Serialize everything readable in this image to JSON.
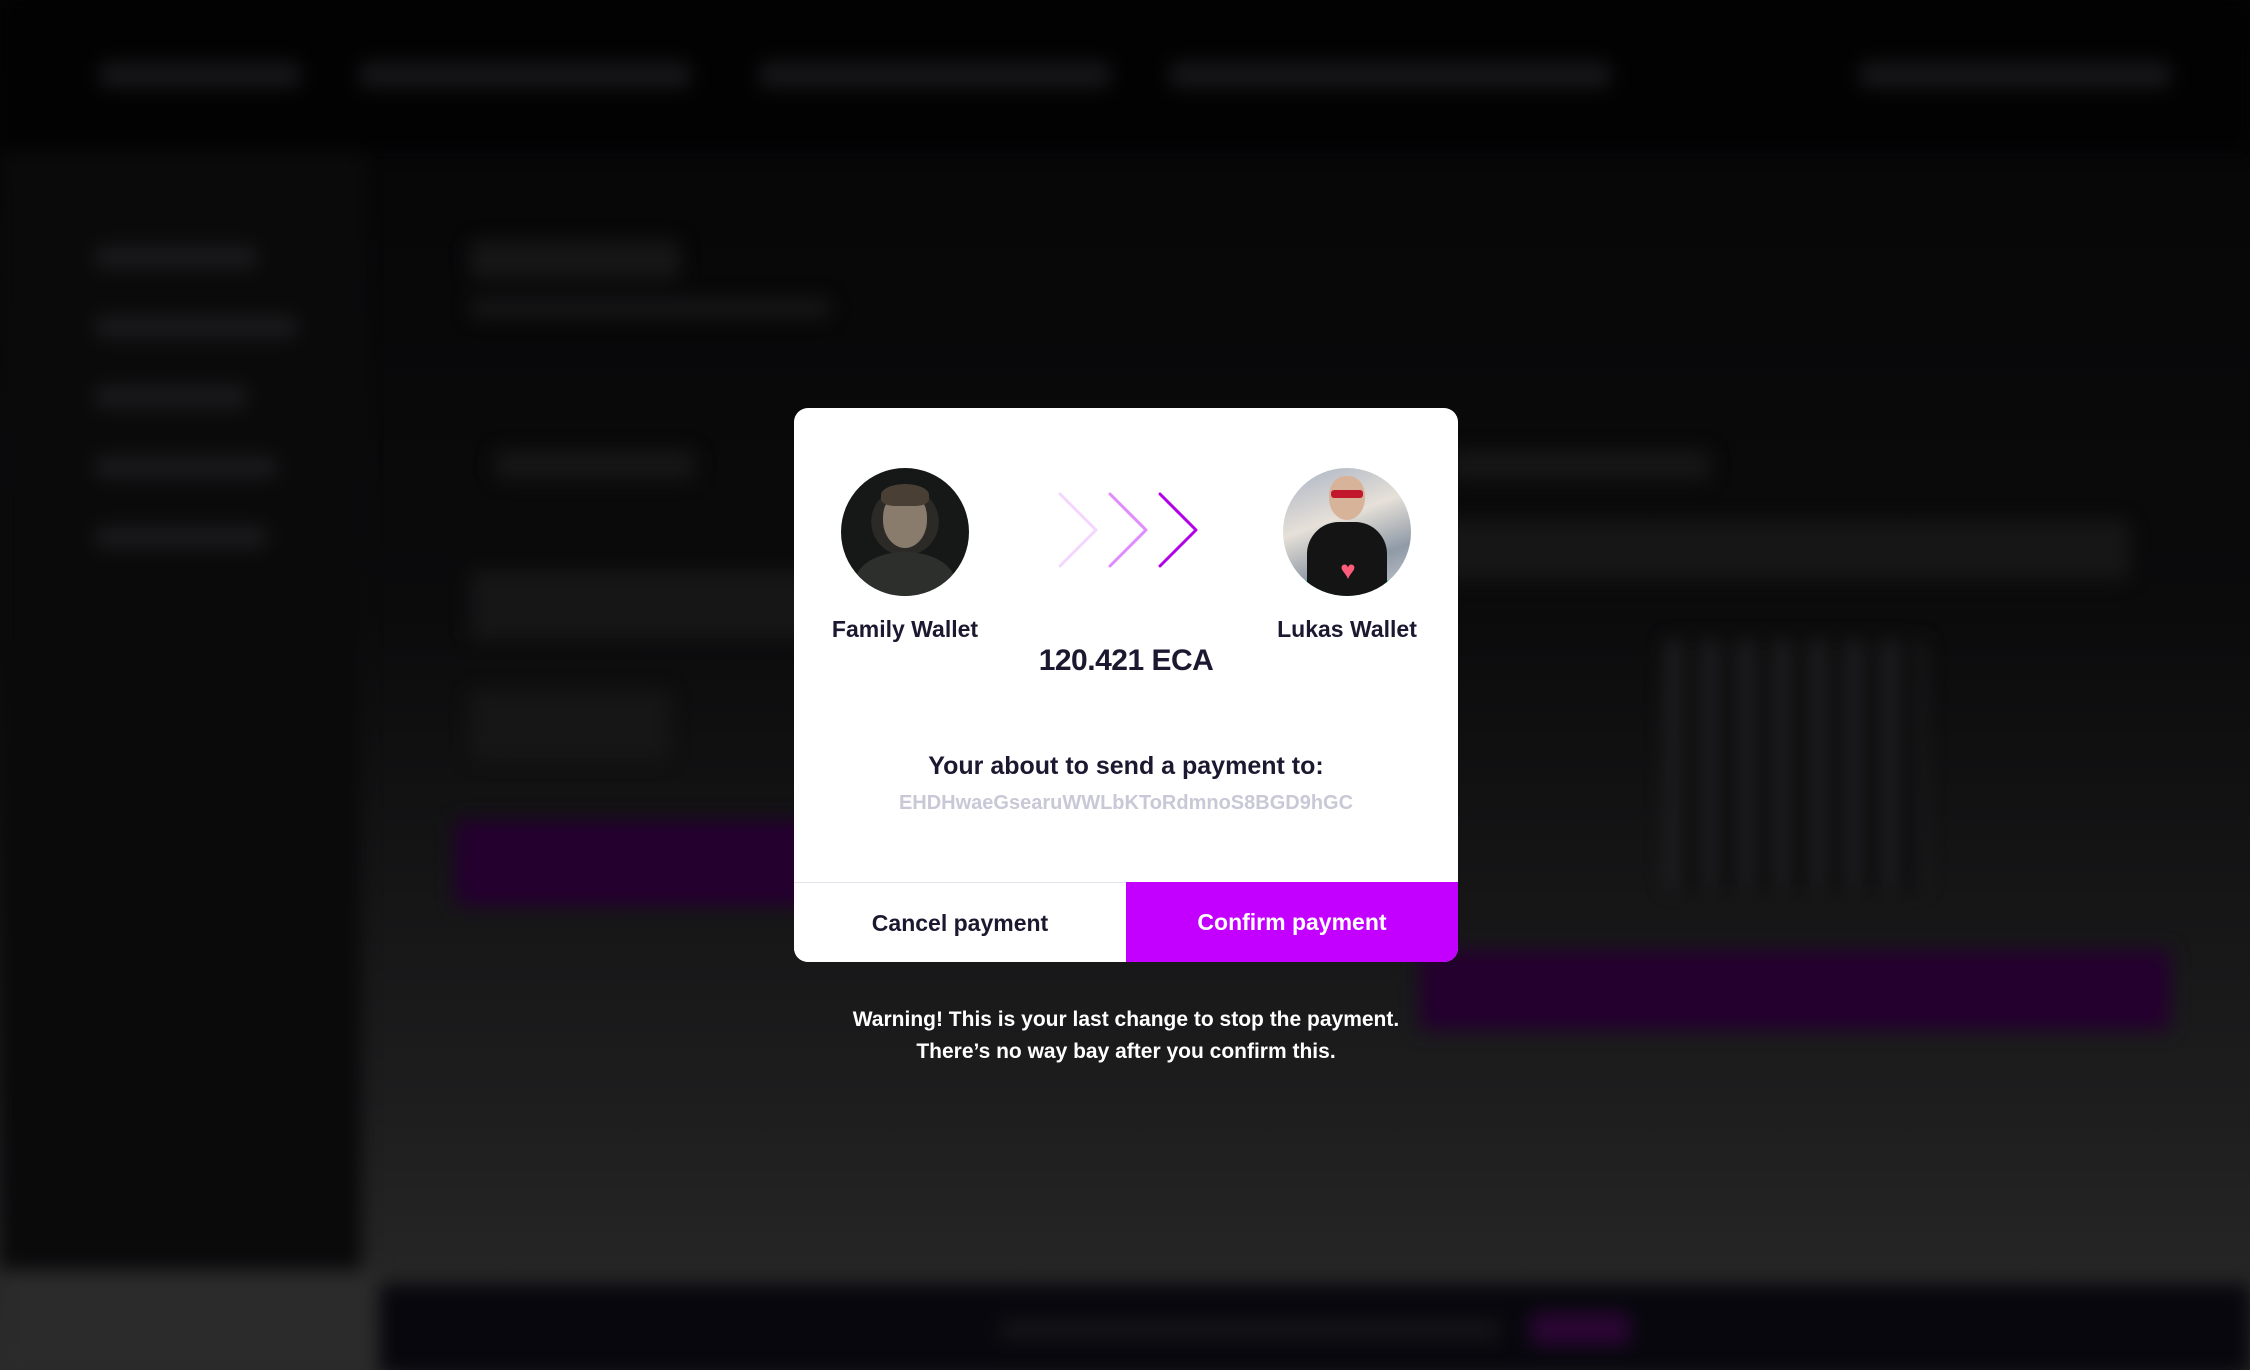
{
  "modal": {
    "from_wallet": "Family Wallet",
    "to_wallet": "Lukas Wallet",
    "amount": "120.421 ECA",
    "message": "Your about to send a payment to:",
    "address": "EHDHwaeGsearuWWLbKToRdmnoS8BGD9hGC",
    "cancel_label": "Cancel payment",
    "confirm_label": "Confirm payment"
  },
  "warning": {
    "line1": "Warning! This is your last change to stop the payment.",
    "line2": "There’s no way bay after you confirm this."
  },
  "colors": {
    "accent": "#c300ff",
    "text_dark": "#1b1830",
    "address": "#c9c8d6"
  },
  "icons": {
    "arrows": "chevron-right-triple-icon"
  }
}
